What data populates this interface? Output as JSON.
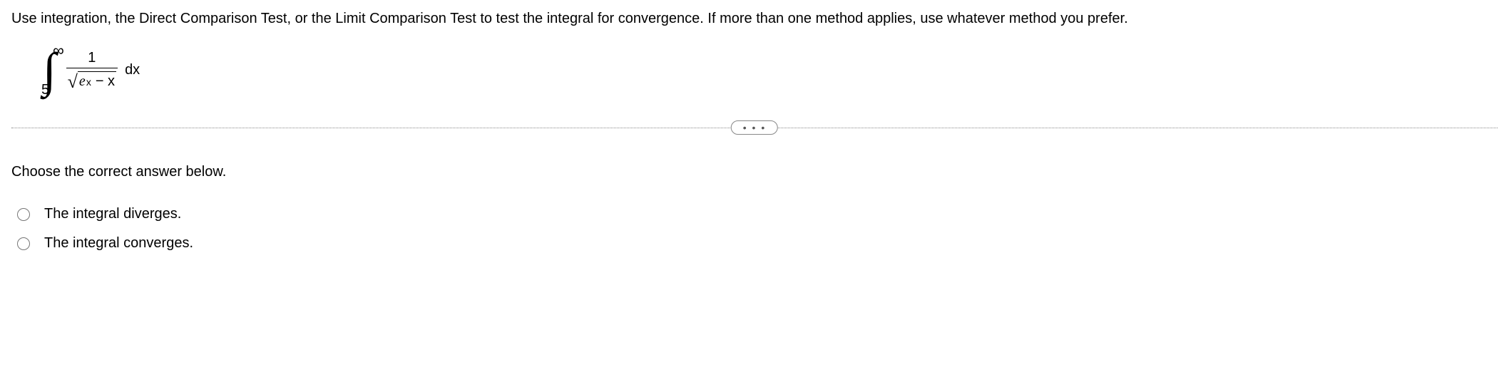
{
  "instruction": "Use integration, the Direct Comparison Test, or the Limit Comparison Test to test the integral for convergence. If more than one method applies, use whatever method you prefer.",
  "integral": {
    "upper_limit": "∞",
    "lower_limit": "5",
    "numerator": "1",
    "denominator_ex_base": "e",
    "denominator_ex_exp": "x",
    "denominator_minus": " − x",
    "dx": "dx"
  },
  "divider_dots": "• • •",
  "prompt": "Choose the correct answer below.",
  "options": [
    {
      "label": "The integral diverges."
    },
    {
      "label": "The integral converges."
    }
  ]
}
